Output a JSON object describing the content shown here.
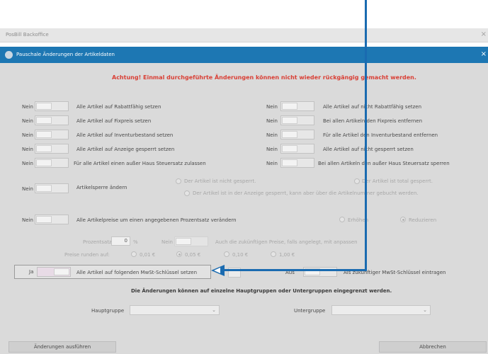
{
  "app": {
    "title": "PosBill Backoffice",
    "close": "×"
  },
  "dialog": {
    "title": "Pauschale Änderungen der Artikeldaten",
    "close": "×"
  },
  "warning": "Achtung! Einmal durchgeführte Änderungen können nicht wieder rückgängig gemacht werden.",
  "left_rows": [
    {
      "state": "Nein",
      "label": "Alle Artikel auf Rabattfähig setzen"
    },
    {
      "state": "Nein",
      "label": "Alle Artikel auf Fixpreis setzen"
    },
    {
      "state": "Nein",
      "label": "Alle Artikel auf Inventurbestand setzen"
    },
    {
      "state": "Nein",
      "label": "Alle Artikel auf Anzeige gesperrt setzen"
    },
    {
      "state": "Nein",
      "label": "Für alle Artikel einen außer Haus Steuersatz zulassen"
    }
  ],
  "right_rows": [
    {
      "state": "Nein",
      "label": "Alle Artikel auf nicht Rabattfähig setzen"
    },
    {
      "state": "Nein",
      "label": "Bei allen Artikeln den Fixpreis entfernen"
    },
    {
      "state": "Nein",
      "label": "Für alle Artikel den Inventurbestand entfernen"
    },
    {
      "state": "Nein",
      "label": "Alle Artikel auf nicht gesperrt setzen"
    },
    {
      "state": "Nein",
      "label": "Bei allen Artikeln den außer Haus Steuersatz sperren"
    }
  ],
  "sperre": {
    "state": "Nein",
    "label": "Artikelsperre ändern",
    "opt_not_locked": "Der Artikel ist nicht gesperrt.",
    "opt_total": "Der Artikel ist total gesperrt.",
    "opt_display": "Der Artikel ist in der Anzeige gesperrt, kann aber über die Artikelnummer gebucht werden."
  },
  "preise": {
    "state": "Nein",
    "label": "Alle Artikelpreise um einen angegebenen Prozentsatz verändern",
    "opt_up": "Erhöhen",
    "opt_down": "Reduzieren",
    "pct_label": "Prozentsatz",
    "pct_value": "0",
    "pct_unit": "%",
    "future_state": "Nein",
    "future_label": "Auch die zukünftigen Preise, falls angelegt, mit  anpassen",
    "round_label": "Preise runden auf:",
    "round_opts": [
      "0,01 €",
      "0,05 €",
      "0,10 €",
      "1,00 €"
    ]
  },
  "mwst": {
    "state": "Ja",
    "label": "Alle Artikel auf folgenden MwSt-Schlüssel setzen",
    "mid": "Aus",
    "right_label": "Als zukünftiger MwSt-Schlüssel eintragen"
  },
  "info": "Die Änderungen können auf einzelne Hauptgruppen oder Untergruppen eingegrenzt werden.",
  "hauptgruppe": {
    "label": "Hauptgruppe",
    "value": ""
  },
  "untergruppe": {
    "label": "Untergruppe",
    "value": ""
  },
  "buttons": {
    "apply": "Änderungen ausführen",
    "cancel": "Abbrechen"
  },
  "colors": {
    "accent": "#1d77b3",
    "warning": "#d94036",
    "annotation": "#1a6bb0"
  }
}
